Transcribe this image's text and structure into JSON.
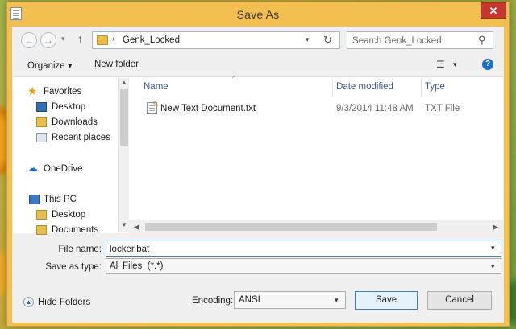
{
  "window": {
    "title": "Save As",
    "close_glyph": "✕"
  },
  "address_bar": {
    "path": "Genk_Locked",
    "separator_glyph": "›",
    "back_glyph": "←",
    "forward_glyph": "→",
    "history_dropdown_glyph": "▾",
    "up_glyph": "↑",
    "dropdown_glyph": "▾",
    "refresh_glyph": "↻"
  },
  "search": {
    "placeholder": "Search Genk_Locked",
    "icon_glyph": "⚲"
  },
  "toolbar": {
    "organize_label": "Organize ▾",
    "new_folder_label": "New folder",
    "view_glyph": "☰",
    "view_dropdown_glyph": "▾",
    "help_glyph": "?"
  },
  "nav": {
    "items": [
      {
        "label": "Favorites",
        "icon": "star-icon"
      },
      {
        "label": "Desktop",
        "icon": "desktop-icon"
      },
      {
        "label": "Downloads",
        "icon": "downloads-icon"
      },
      {
        "label": "Recent places",
        "icon": "recent-places-icon"
      },
      {
        "label": "OneDrive",
        "icon": "cloud-icon"
      },
      {
        "label": "This PC",
        "icon": "computer-icon"
      },
      {
        "label": "Desktop",
        "icon": "desktop-icon"
      },
      {
        "label": "Documents",
        "icon": "folder-icon"
      }
    ],
    "glyphs": {
      "star": "★",
      "cloud": "☁",
      "scroll_up": "▲",
      "scroll_down": "▼"
    }
  },
  "file_list": {
    "columns": [
      "Name",
      "Date modified",
      "Type"
    ],
    "sort_glyph": "^",
    "rows": [
      {
        "name": "New Text Document.txt",
        "date_modified": "9/3/2014 11:48 AM",
        "type": "TXT File"
      }
    ],
    "file_icon_glyph": "✎",
    "scroll_left_glyph": "◀",
    "scroll_right_glyph": "▶"
  },
  "form": {
    "file_name_label": "File name:",
    "file_name_value": "locker.bat",
    "save_as_type_label": "Save as type:",
    "save_as_type_value": "All Files  (*.*)",
    "dropdown_glyph": "▾"
  },
  "bottom": {
    "hide_folders_label": "Hide Folders",
    "hide_folders_glyph": "▲",
    "encoding_label": "Encoding:",
    "encoding_value": "ANSI",
    "save_label": "Save",
    "cancel_label": "Cancel"
  },
  "colors": {
    "title_bar": "#f3bf51",
    "close_button": "#c7372f",
    "accent_blue": "#3c7fb1",
    "column_header_text": "#3e5a8a",
    "client_background": "#f0f0f0"
  }
}
